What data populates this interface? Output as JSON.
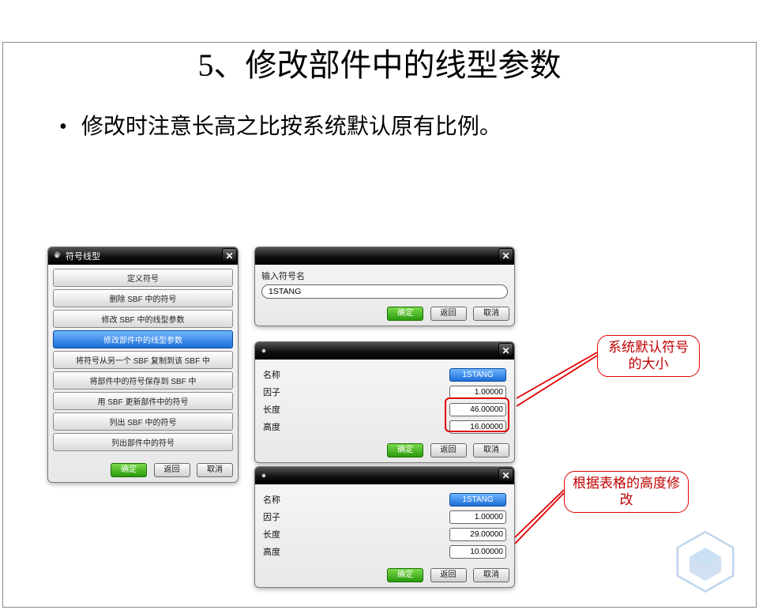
{
  "title": "5、修改部件中的线型参数",
  "bullet": "修改时注意长高之比按系统默认原有比例。",
  "dialog1": {
    "title": "符号线型",
    "items": [
      "定义符号",
      "删除 SBF 中的符号",
      "修改 SBF 中的线型参数",
      "修改部件中的线型参数",
      "将符号从另一个 SBF 复制到该 SBF 中",
      "将部件中的符号保存到 SBF 中",
      "用 SBF 更新部件中的符号",
      "列出 SBF 中的符号",
      "列出部件中的符号"
    ],
    "ok": "确定",
    "back": "返回",
    "cancel": "取消"
  },
  "dialog2": {
    "label": "输入符号名",
    "value": "1STANG",
    "ok": "确定",
    "back": "返回",
    "cancel": "取消"
  },
  "dialog3": {
    "rows": {
      "name_label": "名称",
      "name_value": "1STANG",
      "factor_label": "因子",
      "factor_value": "1.00000",
      "length_label": "长度",
      "length_value": "46.00000",
      "height_label": "高度",
      "height_value": "16.00000"
    },
    "ok": "确定",
    "back": "返回",
    "cancel": "取消"
  },
  "dialog4": {
    "rows": {
      "name_label": "名称",
      "name_value": "1STANG",
      "factor_label": "因子",
      "factor_value": "1.00000",
      "length_label": "长度",
      "length_value": "29.00000",
      "height_label": "高度",
      "height_value": "10.00000"
    },
    "ok": "确定",
    "back": "返回",
    "cancel": "取消"
  },
  "callout1": "系统默认符号的大小",
  "callout2": "根据表格的高度修改",
  "icons": {
    "gear": "gear-icon",
    "close": "close-icon"
  },
  "colors": {
    "accent_red": "#e00000",
    "accent_blue": "#1d6fd8",
    "accent_green": "#2a9a0e"
  }
}
